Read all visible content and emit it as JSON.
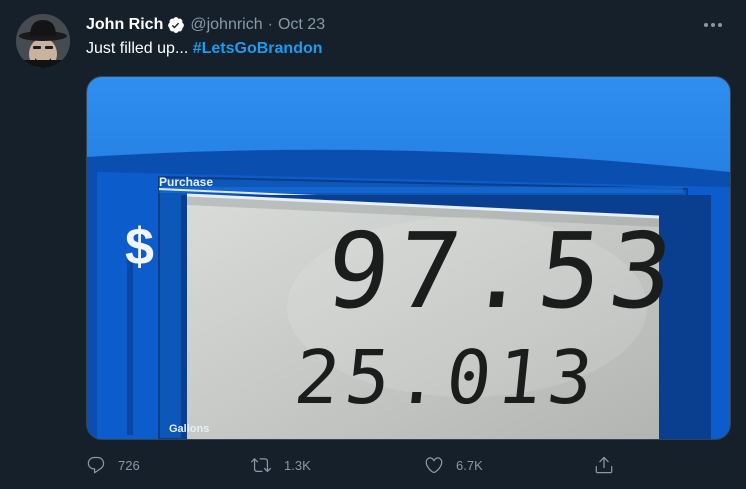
{
  "tweet": {
    "author_name": "John Rich",
    "handle": "@johnrich",
    "separator": "·",
    "date": "Oct 23",
    "text_prefix": "Just filled up... ",
    "hashtag": "#LetsGoBrandon"
  },
  "pump": {
    "purchase_label": "Purchase",
    "gallons_label": "Gallons",
    "currency_symbol": "$",
    "price_digits": "97.53",
    "gallons_digits": "25.013"
  },
  "stats": {
    "replies": "726",
    "retweets": "1.3K",
    "likes": "6.7K"
  },
  "colors": {
    "background": "#15202b",
    "accent": "#1d9bf0",
    "muted": "#8899a6",
    "pump_blue": "#0b5fc4"
  },
  "icons": [
    "verified-badge-icon",
    "more-icon",
    "reply-icon",
    "retweet-icon",
    "like-icon",
    "share-icon"
  ]
}
